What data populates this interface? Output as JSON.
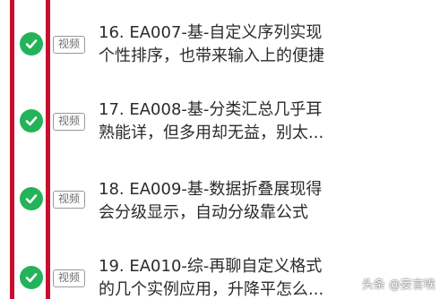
{
  "colors": {
    "check": "#23b35a",
    "red_bar": "#c8102e",
    "tag_border": "#9a9a9a",
    "text": "#2b2b2b"
  },
  "lessons": [
    {
      "status_icon": "check-circle-icon",
      "tag": "视频",
      "line1": "16. EA007-基-自定义序列实现",
      "line2": "个性排序，也带来输入上的便捷"
    },
    {
      "status_icon": "check-circle-icon",
      "tag": "视频",
      "line1": "17. EA008-基-分类汇总几乎耳",
      "line2": "熟能详，但多用却无益，别太..."
    },
    {
      "status_icon": "check-circle-icon",
      "tag": "视频",
      "line1": "18. EA009-基-数据折叠展现得",
      "line2": "会分级显示，自动分级靠公式"
    },
    {
      "status_icon": "check-circle-icon",
      "tag": "视频",
      "line1": "19. EA010-综-再聊自定义格式",
      "line2": "的几个实例应用，升降平怎么..."
    }
  ],
  "watermark": "头条 @妄言唉"
}
